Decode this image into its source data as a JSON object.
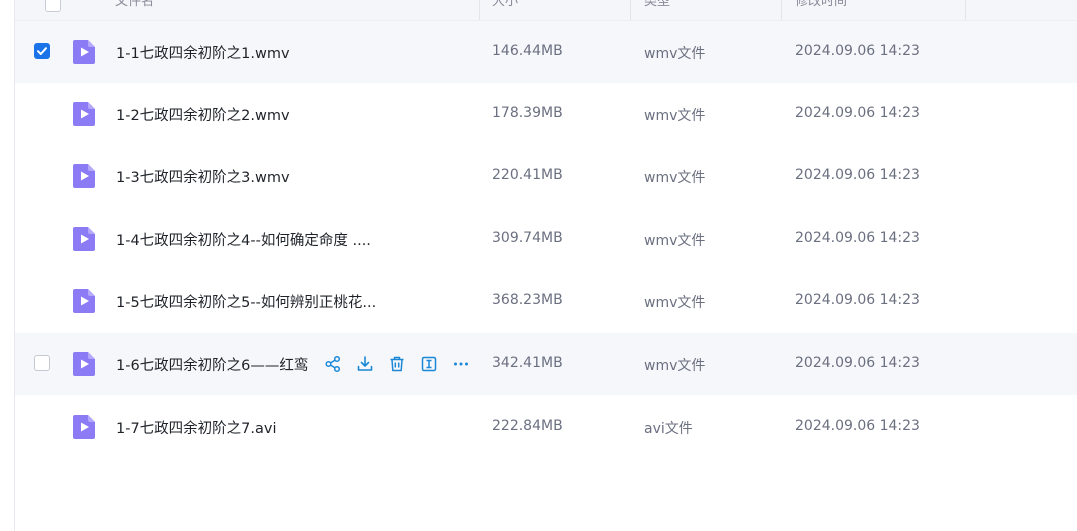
{
  "header": {
    "col_name": "文件名",
    "col_size": "大小",
    "col_type": "类型",
    "col_time": "修改时间"
  },
  "colors": {
    "accent": "#1a73e8",
    "icon_purple": "#8b7cf6",
    "action_blue": "#1a88d6"
  },
  "rows": [
    {
      "name": "1-1七政四余初阶之1.wmv",
      "size": "146.44MB",
      "type": "wmv文件",
      "time": "2024.09.06 14:23",
      "checked": true
    },
    {
      "name": "1-2七政四余初阶之2.wmv",
      "size": "178.39MB",
      "type": "wmv文件",
      "time": "2024.09.06 14:23"
    },
    {
      "name": "1-3七政四余初阶之3.wmv",
      "size": "220.41MB",
      "type": "wmv文件",
      "time": "2024.09.06 14:23"
    },
    {
      "name": "1-4七政四余初阶之4--如何确定命度 ....",
      "size": "309.74MB",
      "type": "wmv文件",
      "time": "2024.09.06 14:23"
    },
    {
      "name": "1-5七政四余初阶之5--如何辨别正桃花...",
      "size": "368.23MB",
      "type": "wmv文件",
      "time": "2024.09.06 14:23"
    },
    {
      "name": "1-6七政四余初阶之6——红鸾",
      "size": "342.41MB",
      "type": "wmv文件",
      "time": "2024.09.06 14:23",
      "hovered": true
    },
    {
      "name": "1-7七政四余初阶之7.avi",
      "size": "222.84MB",
      "type": "avi文件",
      "time": "2024.09.06 14:23"
    }
  ],
  "row_actions": [
    "share-icon",
    "download-icon",
    "delete-icon",
    "rename-icon",
    "more-icon"
  ]
}
